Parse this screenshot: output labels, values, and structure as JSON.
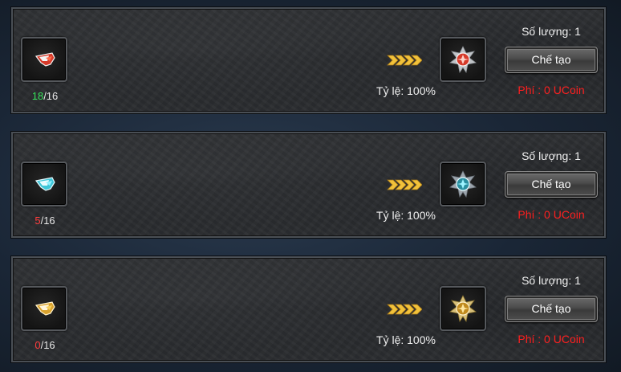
{
  "recipes": [
    {
      "material_icon": "red-wing-fragment-icon",
      "material_have": "18",
      "material_need": "/16",
      "arrows_icon": "gold-chevrons-icon",
      "rate_text": "Tỷ lệ: 100%",
      "result_icon": "red-wing-emblem-icon",
      "quantity_text": "Số lượng: 1",
      "craft_label": "Chế tạo",
      "fee_text": "Phí : 0 UCoin",
      "accent": "#d63a2a"
    },
    {
      "material_icon": "cyan-wing-fragment-icon",
      "material_have": "5",
      "material_need": "/16",
      "arrows_icon": "gold-chevrons-icon",
      "rate_text": "Tỷ lệ: 100%",
      "result_icon": "cyan-wing-emblem-icon",
      "quantity_text": "Số lượng: 1",
      "craft_label": "Chế tạo",
      "fee_text": "Phí : 0 UCoin",
      "accent": "#4fd8e8"
    },
    {
      "material_icon": "gold-wing-fragment-icon",
      "material_have": "0",
      "material_need": "/16",
      "arrows_icon": "gold-chevrons-icon",
      "rate_text": "Tỷ lệ: 100%",
      "result_icon": "gold-wing-emblem-icon",
      "quantity_text": "Số lượng: 1",
      "craft_label": "Chế tạo",
      "fee_text": "Phí : 0 UCoin",
      "accent": "#e8b83a"
    }
  ],
  "colors": {
    "have_enough": "#37e05a",
    "have_short": "#ff3c3c",
    "fee": "#ff1f1f"
  }
}
